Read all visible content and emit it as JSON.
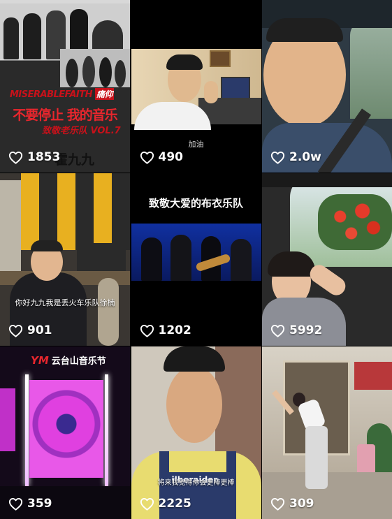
{
  "tiles": [
    {
      "likes": "1853",
      "poster": {
        "band": "MISERABLEFAITH",
        "band_cn": "痛仰",
        "slogan": "不要停止 我的音乐",
        "subtitle": "致敬老乐队 VOL.7",
        "overlay": "霍九九"
      }
    },
    {
      "likes": "490",
      "caption": "加油"
    },
    {
      "likes": "2.0w"
    },
    {
      "likes": "901",
      "caption": "你好九九我是丢火车乐队徐楠"
    },
    {
      "likes": "1202",
      "caption": "致敬大爱的布衣乐队"
    },
    {
      "likes": "5992"
    },
    {
      "likes": "359",
      "logo_mark": "YM",
      "logo_text": "云台山音乐节"
    },
    {
      "likes": "2225",
      "caption": "将来我觉得你会更棒更棒",
      "shirt_text": "ilberaider"
    },
    {
      "likes": "309"
    }
  ],
  "colors": {
    "accent_red": "#e8262d",
    "poster_red": "#c8111a",
    "magenta": "#e040e0"
  }
}
